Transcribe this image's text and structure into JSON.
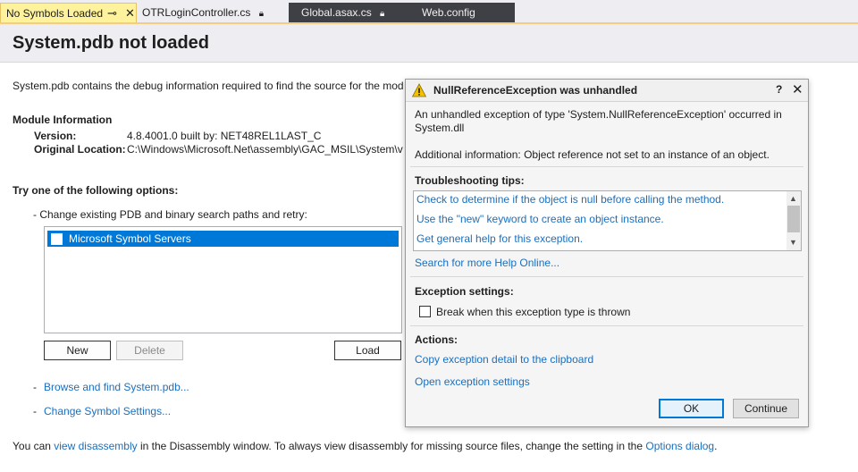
{
  "tabs": [
    {
      "label": "No Symbols Loaded"
    },
    {
      "label": "OTRLoginController.cs"
    },
    {
      "label": "Global.asax.cs"
    },
    {
      "label": "Web.config"
    }
  ],
  "page": {
    "title": "System.pdb not loaded",
    "intro": "System.pdb contains the debug information required to find the source for the mod",
    "module_heading": "Module Information",
    "version_label": "Version:",
    "version_value": "4.8.4001.0 built by: NET48REL1LAST_C",
    "location_label": "Original Location:",
    "location_value": "C:\\Windows\\Microsoft.Net\\assembly\\GAC_MSIL\\System\\v",
    "options_heading": "Try one of the following options:",
    "option_change_paths": "-  Change existing PDB and binary search paths and retry:",
    "symbol_servers": [
      "Microsoft Symbol Servers"
    ],
    "new_label": "New",
    "delete_label": "Delete",
    "load_label": "Load",
    "dash": "-",
    "browse_link": "Browse and find System.pdb...",
    "settings_link": "Change Symbol Settings...",
    "footer_pre": "You can ",
    "footer_link1": "view disassembly",
    "footer_mid": " in the Disassembly window. To always view disassembly for missing source files, change the setting in the ",
    "footer_link2": "Options dialog",
    "footer_post": "."
  },
  "dialog": {
    "title": "NullReferenceException was unhandled",
    "help": "?",
    "close": "✕",
    "message_line1": "An unhandled exception of type 'System.NullReferenceException' occurred in",
    "message_line2": "System.dll",
    "additional": "Additional information: Object reference not set to an instance of an object.",
    "tips_heading": "Troubleshooting tips:",
    "tips": [
      "Check to determine if the object is null before calling the method.",
      "Use the \"new\" keyword to create an object instance.",
      "Get general help for this exception."
    ],
    "search_help": "Search for more Help Online...",
    "settings_heading": "Exception settings:",
    "break_label": "Break when this exception type is thrown",
    "break_checked": false,
    "actions_heading": "Actions:",
    "action_copy": "Copy exception detail to the clipboard",
    "action_open": "Open exception settings",
    "ok_label": "OK",
    "continue_label": "Continue"
  }
}
